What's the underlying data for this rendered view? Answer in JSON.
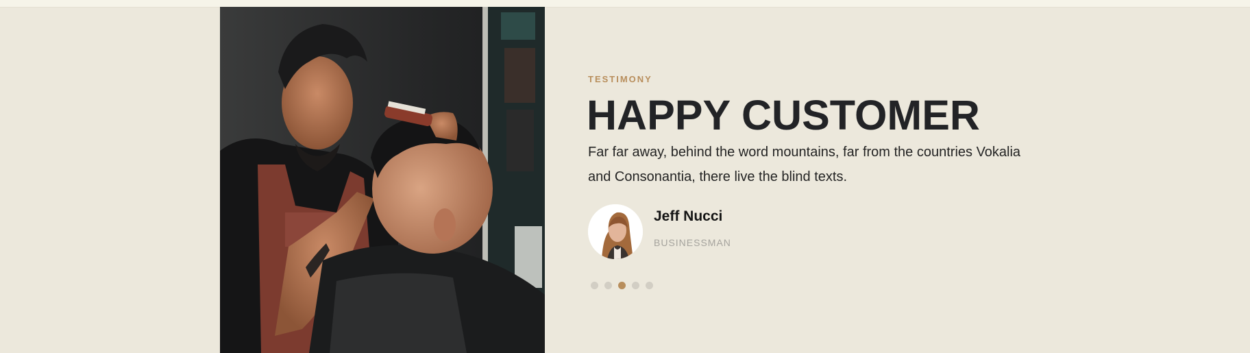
{
  "testimonial": {
    "eyebrow": "TESTIMONY",
    "heading": "HAPPY CUSTOMER",
    "quote": "Far far away, behind the word mountains, far from the countries Vokalia and Consonantia, there live the blind texts.",
    "author_name": "Jeff Nucci",
    "author_role": "BUSINESSMAN"
  },
  "carousel": {
    "dot_count": 5,
    "active_dot": 3
  },
  "colors": {
    "accent": "#b88e5c",
    "background": "#ece8dc",
    "heading": "#222326",
    "muted": "#a5a39d",
    "dot_inactive": "#d2cec4"
  },
  "images": {
    "photo": "barber-cutting-hair-photo",
    "avatar": "customer-avatar-photo"
  }
}
